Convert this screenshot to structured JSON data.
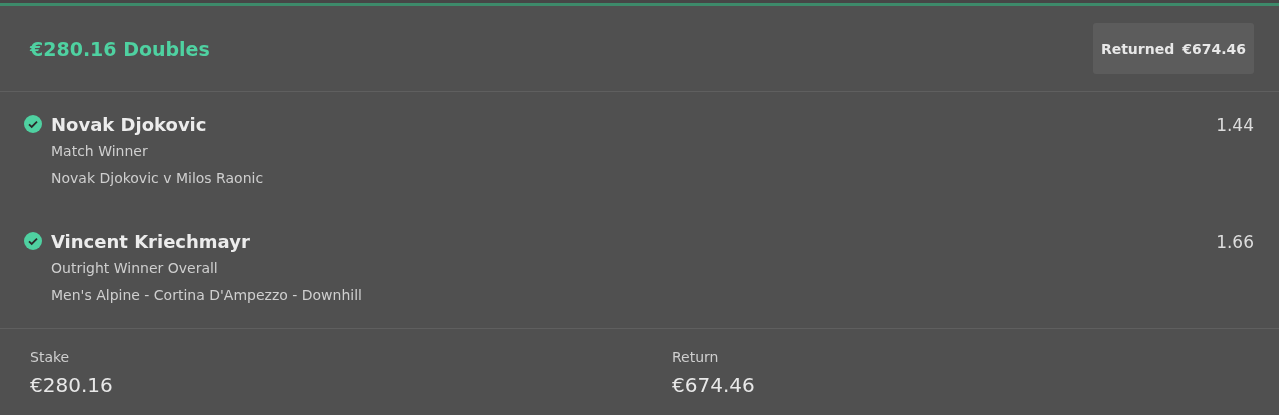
{
  "header": {
    "title": "€280.16 Doubles",
    "badge": {
      "label": "Returned",
      "amount": "€674.46"
    }
  },
  "selections": [
    {
      "name": "Novak Djokovic",
      "won": true,
      "market": "Match Winner",
      "event": "Novak Djokovic v Milos Raonic",
      "odds": "1.44"
    },
    {
      "name": "Vincent Kriechmayr",
      "won": true,
      "market": "Outright Winner Overall",
      "event": "Men's Alpine - Cortina D'Ampezzo - Downhill",
      "odds": "1.66"
    }
  ],
  "footer": [
    {
      "label": "Stake",
      "value": "€280.16"
    },
    {
      "label": "Return",
      "value": "€674.46"
    }
  ]
}
